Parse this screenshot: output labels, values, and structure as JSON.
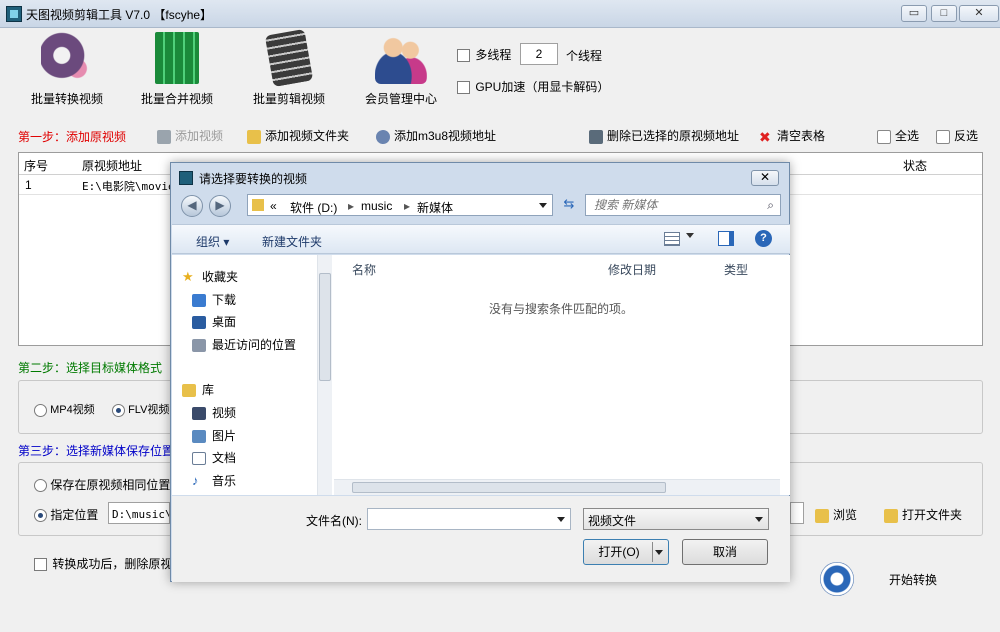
{
  "window": {
    "title": "天图视频剪辑工具 V7.0  【fscyhe】",
    "controls": {
      "minimize": "▭",
      "maximize": "□",
      "close": "✕"
    }
  },
  "toolbar": {
    "items": [
      {
        "label": "批量转换视频",
        "icon": "film-reel-icon"
      },
      {
        "label": "批量合并视频",
        "icon": "building-grid-icon"
      },
      {
        "label": "批量剪辑视频",
        "icon": "film-strip-scissors-icon"
      },
      {
        "label": "会员管理中心",
        "icon": "members-icon"
      }
    ],
    "multithread_label": "多线程",
    "thread_count": "2",
    "thread_unit": "个线程",
    "gpu_label": "GPU加速（用显卡解码）"
  },
  "step1": {
    "label": "第一步：添加原视频",
    "add_video": "添加视频",
    "add_folder": "添加视频文件夹",
    "add_m3u8": "添加m3u8视频地址",
    "delete_selected": "删除已选择的原视频地址",
    "clear_table": "清空表格",
    "select_all": "全选",
    "invert_select": "反选"
  },
  "table": {
    "columns": [
      "序号",
      "原视频地址",
      "状态"
    ],
    "rows": [
      {
        "index": "1",
        "path": "E:\\电影院\\movie"
      }
    ]
  },
  "step2": {
    "label": "第二步：选择目标媒体格式",
    "options": [
      "MP4视频",
      "FLV视频"
    ]
  },
  "step3": {
    "label": "第三步：选择新媒体保存位置",
    "same_location": "保存在原视频相同位置",
    "specify_location": "指定位置",
    "path_value": "D:\\music\\新",
    "browse": "浏览",
    "open_folder": "打开文件夹"
  },
  "footer": {
    "delete_after": "转换成功后，删除原视频",
    "start": "开始转换"
  },
  "dialog": {
    "title": "请选择要转换的视频",
    "close": "✕",
    "breadcrumb": [
      "«",
      "软件 (D:)",
      "music",
      "新媒体"
    ],
    "search_placeholder": "搜索 新媒体",
    "organize": "组织 ▾",
    "new_folder": "新建文件夹",
    "nav": {
      "favorites": "收藏夹",
      "downloads": "下载",
      "desktop": "桌面",
      "recent": "最近访问的位置",
      "library": "库",
      "videos": "视频",
      "pictures": "图片",
      "documents": "文档",
      "music": "音乐"
    },
    "columns": {
      "name": "名称",
      "modified": "修改日期",
      "type": "类型"
    },
    "empty_message": "没有与搜索条件匹配的项。",
    "filename_label": "文件名(N):",
    "filename_value": "",
    "filter_value": "视频文件",
    "open": "打开(O)",
    "cancel": "取消"
  }
}
